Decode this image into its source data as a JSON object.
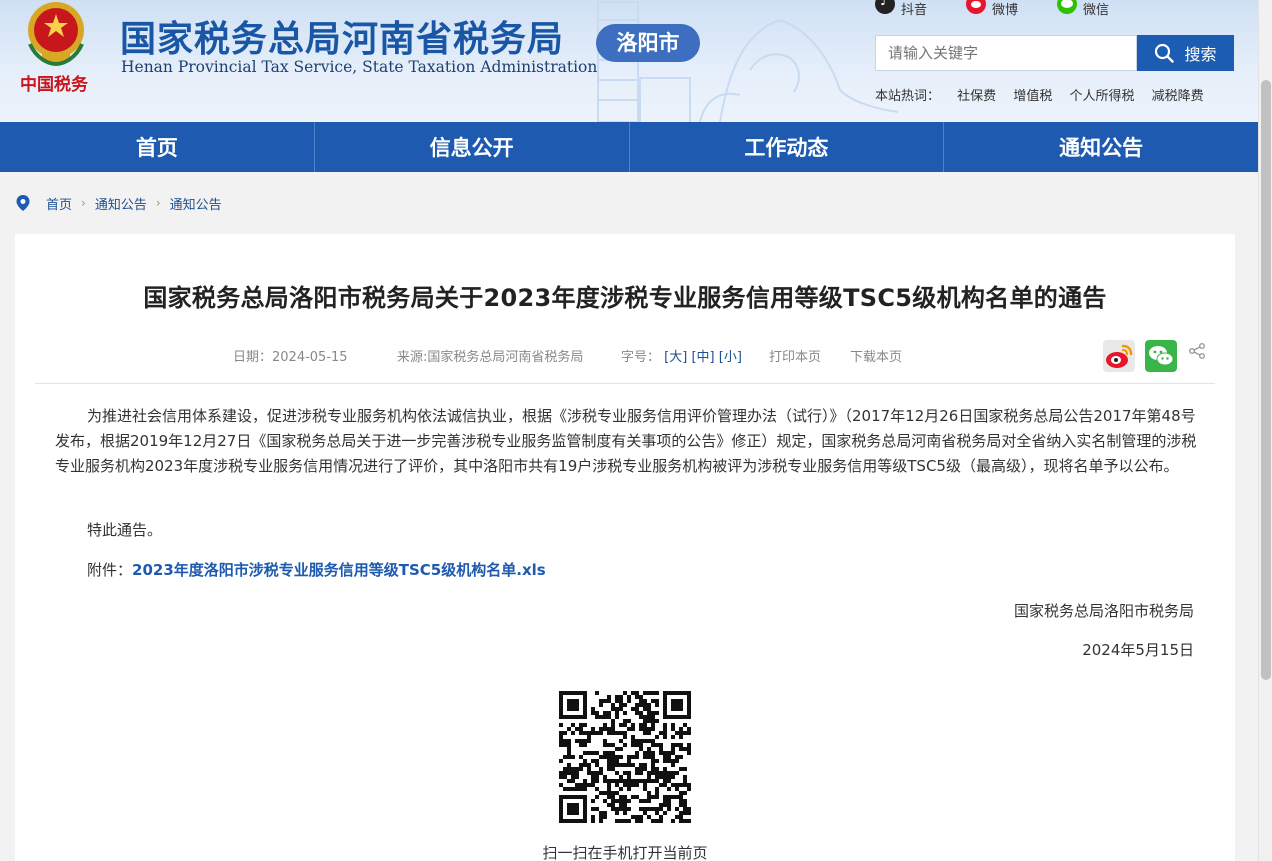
{
  "header": {
    "emblem_text": "中国税务",
    "cn_title": "国家税务总局河南省税务局",
    "en_title": "Henan Provincial Tax Service, State Taxation Administration",
    "city": "洛阳市",
    "social": {
      "tiktok": "抖音",
      "weibo": "微博",
      "wechat": "微信"
    },
    "search": {
      "placeholder": "请输入关键字",
      "button": "搜索"
    },
    "hot_words": {
      "label": "本站热词：",
      "items": [
        "社保费",
        "增值税",
        "个人所得税",
        "减税降费"
      ]
    }
  },
  "nav": [
    "首页",
    "信息公开",
    "工作动态",
    "通知公告"
  ],
  "breadcrumb": [
    "首页",
    "通知公告",
    "通知公告"
  ],
  "article": {
    "title": "国家税务总局洛阳市税务局关于2023年度涉税专业服务信用等级TSC5级机构名单的通告",
    "date": "日期：2024-05-15",
    "source": "来源:国家税务总局河南省税务局",
    "font_size_label": "字号：",
    "font_sizes": [
      "[大]",
      "[中]",
      "[小]"
    ],
    "print": "打印本页",
    "download": "下载本页",
    "body": "为推进社会信用体系建设，促进涉税专业服务机构依法诚信执业，根据《涉税专业服务信用评价管理办法（试行）》（2017年12月26日国家税务总局公告2017年第48号发布，根据2019年12月27日《国家税务总局关于进一步完善涉税专业服务监管制度有关事项的公告》修正）规定，国家税务总局河南省税务局对全省纳入实名制管理的涉税专业服务机构2023年度涉税专业服务信用情况进行了评价，其中洛阳市共有19户涉税专业服务机构被评为涉税专业服务信用等级TSC5级（最高级），现将名单予以公布。",
    "closing": "特此通告。",
    "attachment_label": "附件：",
    "attachment": "2023年度洛阳市涉税专业服务信用等级TSC5级机构名单.xls",
    "signer": "国家税务总局洛阳市税务局",
    "sign_date": "2024年5月15日",
    "qr_caption": "扫一扫在手机打开当前页"
  },
  "colors": {
    "brand_blue": "#1d5ab0",
    "title_blue": "#1a56a6",
    "emblem_red": "#c8161d"
  }
}
